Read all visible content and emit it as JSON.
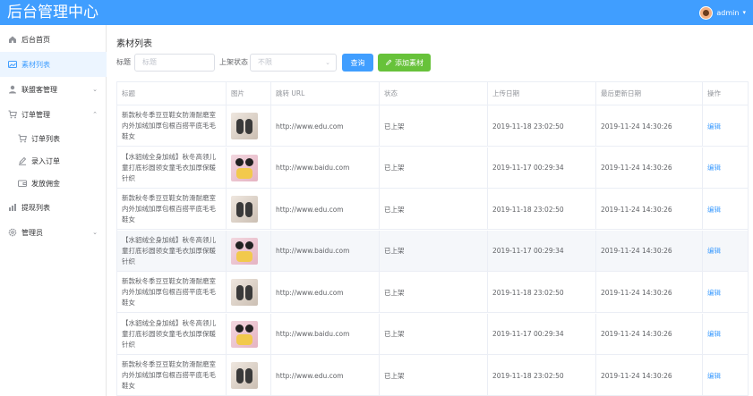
{
  "app": {
    "title": "后台管理中心",
    "user": "admin"
  },
  "sidebar": {
    "items": [
      {
        "label": "后台首页",
        "icon": "home-icon"
      },
      {
        "label": "素材列表",
        "icon": "image-icon"
      },
      {
        "label": "联盟客管理",
        "icon": "user-icon"
      },
      {
        "label": "订单管理",
        "icon": "cart-icon"
      },
      {
        "label": "订单列表",
        "icon": "cart-icon"
      },
      {
        "label": "录入订单",
        "icon": "edit-icon"
      },
      {
        "label": "发放佣金",
        "icon": "wallet-icon"
      },
      {
        "label": "提现列表",
        "icon": "chart-icon"
      },
      {
        "label": "管理员",
        "icon": "gear-icon"
      }
    ]
  },
  "page": {
    "title": "素材列表"
  },
  "filters": {
    "title_label": "标题",
    "title_placeholder": "标题",
    "status_label": "上架状态",
    "status_value": "不限",
    "query_button": "查询",
    "add_button": "添加素材"
  },
  "table": {
    "headers": [
      "标题",
      "图片",
      "跳转 URL",
      "状态",
      "上传日期",
      "最后更新日期",
      "操作"
    ],
    "rows": [
      {
        "title": "新款秋冬季豆豆鞋女防滑耐磨室内外加绒加厚包根百搭平底毛毛鞋女",
        "image": "shoe",
        "url": "http://www.edu.com",
        "status": "已上架",
        "uploaded": "2019-11-18 23:02:50",
        "updated": "2019-11-24 14:30:26",
        "action": "编辑"
      },
      {
        "title": "【水貂绒全身加绒】秋冬高领儿童打底衫圆领女童毛衣加厚保暖针织",
        "image": "toy",
        "url": "http://www.baidu.com",
        "status": "已上架",
        "uploaded": "2019-11-17 00:29:34",
        "updated": "2019-11-24 14:30:26",
        "action": "编辑"
      },
      {
        "title": "新款秋冬季豆豆鞋女防滑耐磨室内外加绒加厚包根百搭平底毛毛鞋女",
        "image": "shoe",
        "url": "http://www.edu.com",
        "status": "已上架",
        "uploaded": "2019-11-18 23:02:50",
        "updated": "2019-11-24 14:30:26",
        "action": "编辑"
      },
      {
        "title": "【水貂绒全身加绒】秋冬高领儿童打底衫圆领女童毛衣加厚保暖针织",
        "image": "toy",
        "url": "http://www.baidu.com",
        "status": "已上架",
        "uploaded": "2019-11-17 00:29:34",
        "updated": "2019-11-24 14:30:26",
        "action": "编辑"
      },
      {
        "title": "新款秋冬季豆豆鞋女防滑耐磨室内外加绒加厚包根百搭平底毛毛鞋女",
        "image": "shoe",
        "url": "http://www.edu.com",
        "status": "已上架",
        "uploaded": "2019-11-18 23:02:50",
        "updated": "2019-11-24 14:30:26",
        "action": "编辑"
      },
      {
        "title": "【水貂绒全身加绒】秋冬高领儿童打底衫圆领女童毛衣加厚保暖针织",
        "image": "toy",
        "url": "http://www.baidu.com",
        "status": "已上架",
        "uploaded": "2019-11-17 00:29:34",
        "updated": "2019-11-24 14:30:26",
        "action": "编辑"
      },
      {
        "title": "新款秋冬季豆豆鞋女防滑耐磨室内外加绒加厚包根百搭平底毛毛鞋女",
        "image": "shoe",
        "url": "http://www.edu.com",
        "status": "已上架",
        "uploaded": "2019-11-18 23:02:50",
        "updated": "2019-11-24 14:30:26",
        "action": "编辑"
      }
    ]
  },
  "colors": {
    "primary": "#409eff",
    "success": "#67c23a",
    "active_bg": "#ecf5ff"
  }
}
